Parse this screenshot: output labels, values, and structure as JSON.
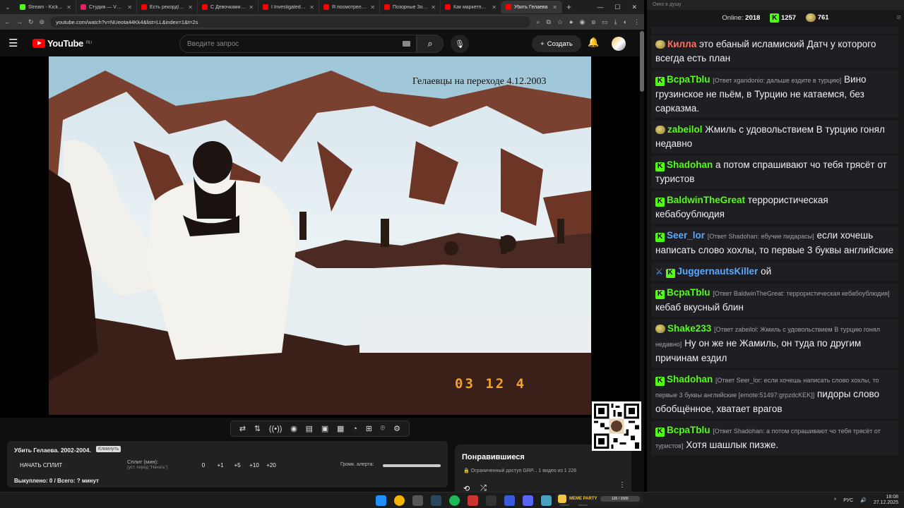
{
  "browser": {
    "tabs": [
      {
        "label": "Stream - Kick Dash",
        "color": "#53fc18"
      },
      {
        "label": "Студия — VK Видео",
        "color": "#e0245e"
      },
      {
        "label": "Есть рекорд! Пере",
        "color": "#ff0000"
      },
      {
        "label": "С Девочками Боле",
        "color": "#ff0000"
      },
      {
        "label": "I Investigated Mine",
        "color": "#ff0000"
      },
      {
        "label": "Я посмотрел все ф",
        "color": "#ff0000"
      },
      {
        "label": "Позорные Зоозащ",
        "color": "#ff0000"
      },
      {
        "label": "Как маркетплейсы",
        "color": "#ff0000"
      },
      {
        "label": "Убить Гелаева",
        "color": "#ff0000",
        "active": true
      }
    ],
    "url": "youtube.com/watch?v=NUeota44Kk4&list=LL&index=1&t=2s"
  },
  "youtube": {
    "logo_text": "YouTube",
    "region": "RU",
    "search_placeholder": "Введите запрос",
    "create_label": "Создать"
  },
  "video": {
    "caption": "Гелаевцы на переходе 4.12.2003",
    "date_stamp": "03 12 4"
  },
  "split_panel": {
    "title": "Убить Гелаева. 2002-2004.",
    "badge": "Кликнуть",
    "start_label": "НАЧАТЬ СПЛИТ",
    "split_label": "Сплит (мин):",
    "split_hint": "(уст. перед \"Начать\")",
    "values": [
      "0",
      "+1",
      "+5",
      "+10",
      "+20"
    ],
    "alert_volume_label": "Громк. алерта:",
    "bought_text": "Выкуплено: 0 / Всего: ? минут"
  },
  "liked_panel": {
    "heading": "Понравившиеся",
    "sub": "Ограниченный доступ GRP...   1 видео из 1 226"
  },
  "chat": {
    "window_title": "Окно в душу",
    "online_label": "Online:",
    "online_count": "2018",
    "kick_count": "1257",
    "emote_count": "761",
    "messages": [
      {
        "user": "Килла",
        "color": "#ff6f61",
        "badge": "emote",
        "reply": "",
        "text": "это ебаный исламиский Датч у которого всегда есть план"
      },
      {
        "user": "BcpaTblu",
        "color": "#53fc18",
        "badge": "kick",
        "reply": "[Ответ xgandonio: дальше ездите в турцию]",
        "text": "Вино грузинское не пьём, в Турцию не катаемся, без сарказма."
      },
      {
        "user": "zabeilol",
        "color": "#53fc18",
        "badge": "emote",
        "reply": "",
        "text": "Жмиль с удовольствием В турцию гонял недавно"
      },
      {
        "user": "Shadohan",
        "color": "#53fc18",
        "badge": "kick",
        "reply": "",
        "text": "а потом спрашивают чо тебя трясёт от туристов"
      },
      {
        "user": "BaldwinTheGreat",
        "color": "#53fc18",
        "badge": "kick",
        "reply": "",
        "text": "террористическая кебабоублюдия"
      },
      {
        "user": "Seer_lor",
        "color": "#5aa9ff",
        "badge": "kick",
        "reply": "[Ответ Shadohan: ебучие пидарасы]",
        "text": "если хочешь написать слово хохлы, то первые 3 буквы английские"
      },
      {
        "user": "JuggernautsKiller",
        "color": "#5aa9ff",
        "badge": "kick2",
        "reply": "",
        "text": "ой"
      },
      {
        "user": "BcpaTblu",
        "color": "#53fc18",
        "badge": "kick",
        "reply": "[Ответ BaldwinTheGreat: террористическая кебабоублюдия]",
        "text": "кебаб вкусный блин"
      },
      {
        "user": "Shake233",
        "color": "#53fc18",
        "badge": "emote",
        "reply": "[Ответ zabeilol: Жмиль с удовольствием В турцию гонял недавно]",
        "text": "Ну он же не Жамиль, он туда по другим причинам ездил"
      },
      {
        "user": "Shadohan",
        "color": "#53fc18",
        "badge": "kick",
        "reply": "[Ответ Seer_lor: если хочешь написать слово хохлы, то первые 3 буквы английские [emote:51497:grpzdcKEK]]",
        "text": "пидоры слово обобщённое, хватает врагов"
      },
      {
        "user": "BcpaTblu",
        "color": "#53fc18",
        "badge": "kick",
        "reply": "[Ответ Shadohan: а потом спрашивают чо тебя трясёт от туристов]",
        "text": "Хотя шашлык пизже."
      }
    ]
  },
  "taskbar": {
    "lang": "РУС",
    "time": "18:08",
    "date": "27.12.2025",
    "meme_label": "MEME PARTY",
    "meme_progress": "125 / 1500"
  }
}
